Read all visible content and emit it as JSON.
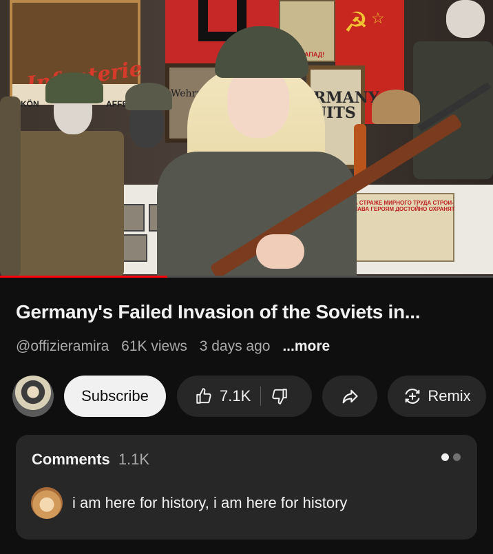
{
  "video": {
    "progress_percent": 34,
    "scene_text": {
      "poster_left_script": "Infanterie",
      "poster_left_small_1": "KÖN",
      "poster_left_small_2": "AFFE",
      "poster_top": "НА ЗАПАД!",
      "newspaper_headline": "RMANY\nUITS",
      "frame_mid": "Wehrmacht",
      "poster_right": "НА СТРАЖЕ МИРНОГО ТРУДА СТРОИ-\nСЛАВА ГЕРОЯМ ДОСТОЙНО ОХРАНЯТ"
    }
  },
  "title": "Germany's Failed Invasion of the Soviets in...",
  "meta": {
    "channel": "@offizieramira",
    "views": "61K views",
    "age": "3 days ago",
    "more": "...more"
  },
  "actions": {
    "subscribe": "Subscribe",
    "likes": "7.1K",
    "remix": "Remix"
  },
  "comments": {
    "label": "Comments",
    "count": "1.1K",
    "top_comment": "i am here for history, i am here for history"
  },
  "colors": {
    "background": "#0f0f0f",
    "pill": "#272727",
    "subscribe_bg": "#f1f1f1",
    "progress": "#ff0000",
    "secondary_text": "#aaaaaa"
  }
}
